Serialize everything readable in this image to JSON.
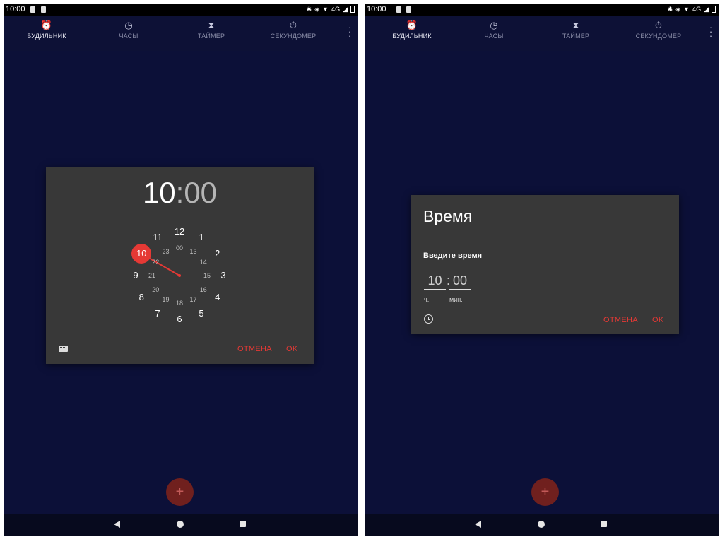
{
  "left_screen": {
    "status_bar": {
      "time": "10:00",
      "network": "4G"
    },
    "tabs": [
      {
        "label": "БУДИЛЬНИК",
        "icon": "alarm-clock-icon",
        "active": true
      },
      {
        "label": "ЧАСЫ",
        "icon": "clock-icon",
        "active": false
      },
      {
        "label": "ТАЙМЕР",
        "icon": "hourglass-icon",
        "active": false
      },
      {
        "label": "СЕКУНДОМЕР",
        "icon": "stopwatch-icon",
        "active": false
      }
    ],
    "dialog": {
      "hours": "10",
      "separator": ":",
      "minutes": "00",
      "selected_hour": "10",
      "outer_numbers": [
        "12",
        "1",
        "2",
        "3",
        "4",
        "5",
        "6",
        "7",
        "8",
        "9",
        "10",
        "11"
      ],
      "inner_numbers": [
        "00",
        "13",
        "14",
        "15",
        "16",
        "17",
        "18",
        "19",
        "20",
        "21",
        "22",
        "23"
      ],
      "cancel_label": "ОТМЕНА",
      "ok_label": "OK"
    },
    "fab_label": "+"
  },
  "right_screen": {
    "status_bar": {
      "time": "10:00",
      "network": "4G"
    },
    "tabs": [
      {
        "label": "БУДИЛЬНИК",
        "icon": "alarm-clock-icon",
        "active": true
      },
      {
        "label": "ЧАСЫ",
        "icon": "clock-icon",
        "active": false
      },
      {
        "label": "ТАЙМЕР",
        "icon": "hourglass-icon",
        "active": false
      },
      {
        "label": "СЕКУНДОМЕР",
        "icon": "stopwatch-icon",
        "active": false
      }
    ],
    "dialog": {
      "title": "Время",
      "subtitle": "Введите время",
      "hours_value": "10",
      "separator": ":",
      "minutes_value": "00",
      "hours_label": "ч.",
      "minutes_label": "мин.",
      "cancel_label": "ОТМЕНА",
      "ok_label": "OK"
    },
    "fab_label": "+"
  },
  "colors": {
    "background": "#0c1038",
    "appbar": "#0d1136",
    "dialog": "#383838",
    "accent": "#e53935",
    "fab": "#70201e"
  }
}
